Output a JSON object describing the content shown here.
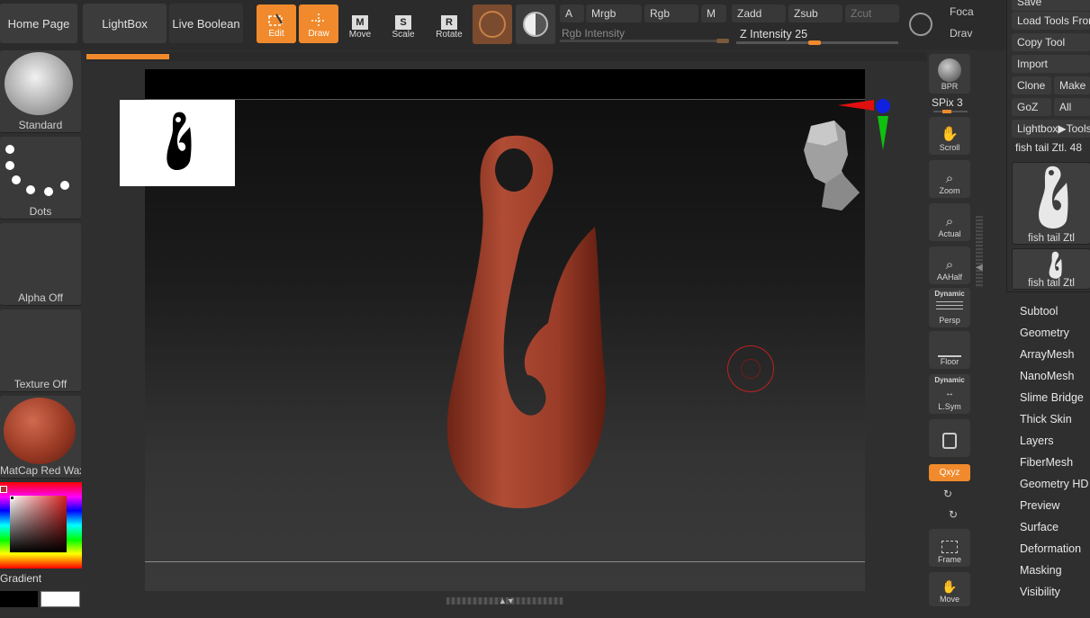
{
  "top_menu": {
    "home_page": "Home Page",
    "lightbox": "LightBox",
    "live_boolean": "Live Boolean"
  },
  "transform": {
    "edit": "Edit",
    "draw": "Draw",
    "move": "Move",
    "scale": "Scale",
    "rotate": "Rotate"
  },
  "channels": {
    "a": "A",
    "mrgb": "Mrgb",
    "rgb": "Rgb",
    "m": "M",
    "rgb_intensity": "Rgb Intensity"
  },
  "depth": {
    "zadd": "Zadd",
    "zsub": "Zsub",
    "zcut": "Zcut",
    "z_intensity_label": "Z Intensity",
    "z_intensity_value": "25",
    "z_intensity": 0.25
  },
  "focal": {
    "label": "Foca",
    "draw_label": "Drav"
  },
  "left_panel": {
    "brush": "Standard",
    "stroke": "Dots",
    "alpha": "Alpha Off",
    "texture": "Texture Off",
    "material": "MatCap Red Wax",
    "gradient": "Gradient"
  },
  "right_shelf": {
    "bpr": "BPR",
    "spix_label": "SPix",
    "spix_value": "3",
    "scroll": "Scroll",
    "zoom": "Zoom",
    "actual": "Actual",
    "aahalf": "AAHalf",
    "dynamic": "Dynamic",
    "persp": "Persp",
    "floor": "Floor",
    "dynamic2": "Dynamic",
    "lsym": "L.Sym",
    "xyz": "Qxyz",
    "frame": "Frame",
    "move": "Move"
  },
  "tool_palette": {
    "save": "Save",
    "load_tools": "Load Tools From",
    "copy_tool": "Copy Tool",
    "import": "Import",
    "clone": "Clone",
    "make": "Make",
    "goz": "GoZ",
    "all": "All",
    "lightbox_tools": "Lightbox▶Tools",
    "current_tool": "fish tail Ztl. 48",
    "thumb1": "fish tail Ztl",
    "thumb2": "fish tail Ztl",
    "submenus": [
      "Subtool",
      "Geometry",
      "ArrayMesh",
      "NanoMesh",
      "Slime Bridge",
      "Thick Skin",
      "Layers",
      "FiberMesh",
      "Geometry HD",
      "Preview",
      "Surface",
      "Deformation",
      "Masking",
      "Visibility"
    ]
  },
  "colors": {
    "accent": "#f08a2c",
    "model": "#a8442f",
    "panel": "#2f2f2f"
  }
}
